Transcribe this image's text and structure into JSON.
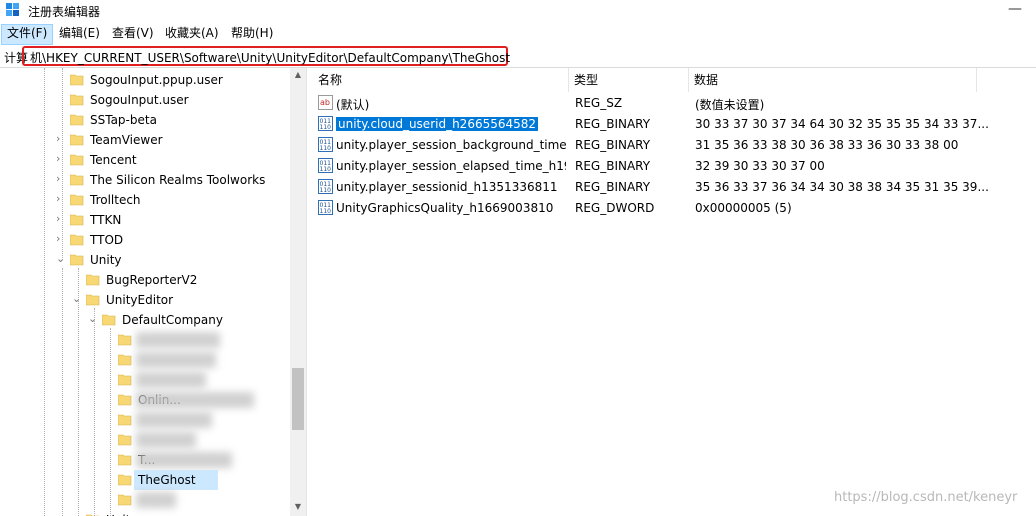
{
  "window": {
    "title": "注册表编辑器",
    "minimize_glyph": "—"
  },
  "menu": [
    "文件(F)",
    "编辑(E)",
    "查看(V)",
    "收藏夹(A)",
    "帮助(H)"
  ],
  "address": {
    "prefix": "计算",
    "path": "机\\HKEY_CURRENT_USER\\Software\\Unity\\UnityEditor\\DefaultCompany\\TheGhost"
  },
  "tree": [
    {
      "label": "SogouInput.ppup.user"
    },
    {
      "label": "SogouInput.user"
    },
    {
      "label": "SSTap-beta"
    },
    {
      "label": "TeamViewer"
    },
    {
      "label": "Tencent"
    },
    {
      "label": "The Silicon Realms Toolworks"
    },
    {
      "label": "Trolltech"
    },
    {
      "label": "TTKN"
    },
    {
      "label": "TTOD"
    },
    {
      "label": "Unity"
    },
    {
      "label": "BugReporterV2"
    },
    {
      "label": "UnityEditor"
    },
    {
      "label": "DefaultCompany"
    },
    {
      "label": ""
    },
    {
      "label": ""
    },
    {
      "label": ""
    },
    {
      "label": "Onlin..."
    },
    {
      "label": ""
    },
    {
      "label": ""
    },
    {
      "label": "T..."
    },
    {
      "label": "TheGhost"
    },
    {
      "label": ""
    },
    {
      "label": "Unity..."
    }
  ],
  "columns": {
    "name": "名称",
    "type": "类型",
    "data": "数据"
  },
  "values": [
    {
      "icon": "string-value-icon",
      "name": "(默认)",
      "type": "REG_SZ",
      "data": "(数值未设置)"
    },
    {
      "icon": "binary-value-icon",
      "name": "unity.cloud_userid_h2665564582",
      "type": "REG_BINARY",
      "data": "30 33 37 30 37 34 64 30 32 35 35 35 34 33 37..."
    },
    {
      "icon": "binary-value-icon",
      "name": "unity.player_session_background_time...",
      "type": "REG_BINARY",
      "data": "31 35 36 33 38 30 36 38 33 36 30 33 38 00"
    },
    {
      "icon": "binary-value-icon",
      "name": "unity.player_session_elapsed_time_h19...",
      "type": "REG_BINARY",
      "data": "32 39 30 33 30 37 00"
    },
    {
      "icon": "binary-value-icon",
      "name": "unity.player_sessionid_h1351336811",
      "type": "REG_BINARY",
      "data": "35 36 33 37 36 34 34 30 38 38 34 35 31 35 39..."
    },
    {
      "icon": "binary-value-icon",
      "name": "UnityGraphicsQuality_h1669003810",
      "type": "REG_DWORD",
      "data": "0x00000005 (5)"
    }
  ],
  "watermark": "https://blog.csdn.net/keneyr",
  "colors": {
    "selection": "#0078d7",
    "tree_selection": "#cce8ff",
    "address_highlight": "#e02020",
    "folder": "#f8d775"
  }
}
